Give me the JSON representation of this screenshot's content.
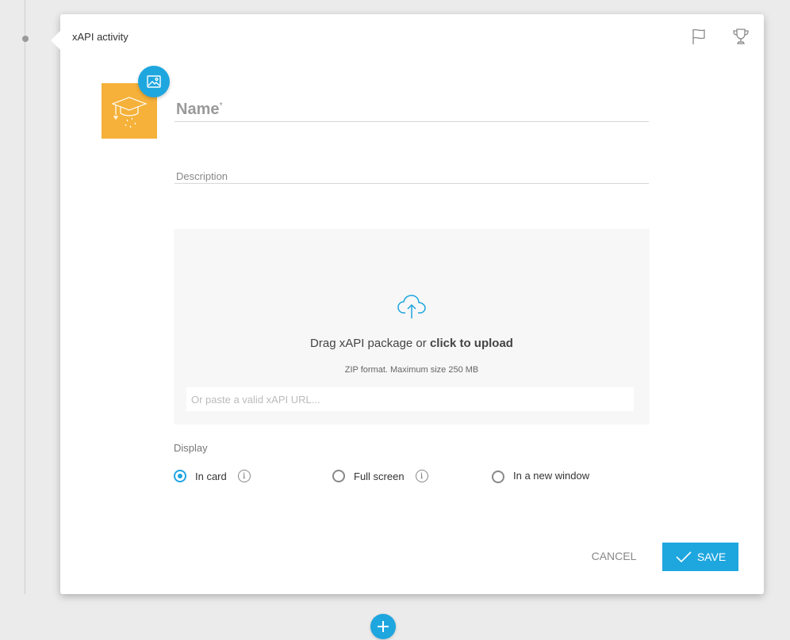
{
  "card": {
    "title": "xAPI activity",
    "header_icons": [
      "flag-icon",
      "trophy-icon"
    ]
  },
  "thumbnail": {
    "icon": "graduation-cap-icon",
    "bg_color": "#f5b13a",
    "change_image_icon": "image-icon"
  },
  "form": {
    "name_label": "Name",
    "name_required_mark": "*",
    "description_label": "Description"
  },
  "upload": {
    "icon": "cloud-upload-icon",
    "drag_text": "Drag xAPI package or ",
    "click_text": "click to upload",
    "format_note": "ZIP format. Maximum size 250 MB",
    "url_placeholder": "Or paste a valid xAPI URL..."
  },
  "display": {
    "label": "Display",
    "options": [
      {
        "label": "In card",
        "checked": true,
        "info": "i"
      },
      {
        "label": "Full screen",
        "checked": false,
        "info": "i"
      },
      {
        "label": "In a new window",
        "checked": false
      }
    ]
  },
  "actions": {
    "cancel": "CANCEL",
    "save": "SAVE"
  },
  "colors": {
    "accent": "#1ea6df",
    "thumbnail": "#f5b13a"
  }
}
